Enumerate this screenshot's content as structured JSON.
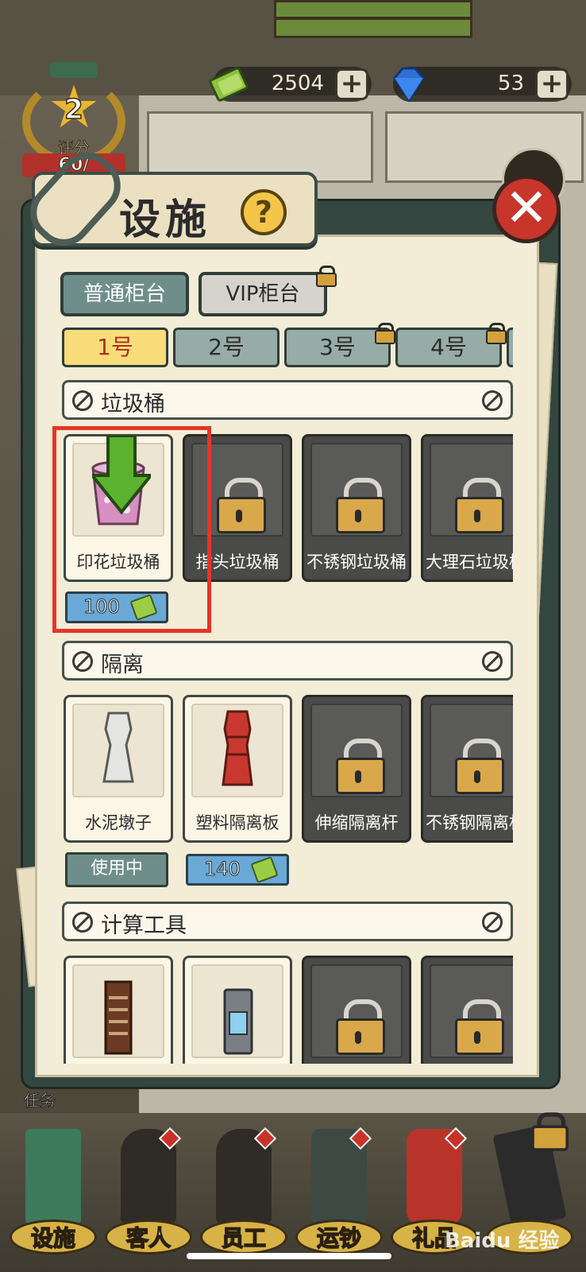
{
  "hud": {
    "rating_level": "2",
    "rating_label": "评分",
    "rating_progress": "60/",
    "cash_value": "2504",
    "gem_value": "53",
    "plus_label": "+"
  },
  "modal": {
    "title": "设施",
    "help_symbol": "?",
    "close_symbol": "✕",
    "counter_type_tabs": [
      {
        "label": "普通柜台",
        "state": "active"
      },
      {
        "label": "VIP柜台",
        "state": "locked"
      }
    ],
    "counter_number_tabs": [
      {
        "label": "1号",
        "state": "active"
      },
      {
        "label": "2号",
        "state": "inactive"
      },
      {
        "label": "3号",
        "state": "locked"
      },
      {
        "label": "4号",
        "state": "locked"
      }
    ],
    "sections": [
      {
        "title": "垃圾桶",
        "items": [
          {
            "name": "印花垃圾桶",
            "locked": false,
            "price": "100"
          },
          {
            "name": "指头垃圾桶",
            "locked": true
          },
          {
            "name": "不锈钢垃圾桶",
            "locked": true
          },
          {
            "name": "大理石垃圾桶",
            "locked": true
          }
        ]
      },
      {
        "title": "隔离",
        "items": [
          {
            "name": "水泥墩子",
            "locked": false,
            "status": "使用中"
          },
          {
            "name": "塑料隔离板",
            "locked": false,
            "price": "140"
          },
          {
            "name": "伸缩隔离杆",
            "locked": true
          },
          {
            "name": "不锈钢隔离杆",
            "locked": true
          }
        ]
      },
      {
        "title": "计算工具",
        "items": [
          {
            "name": "",
            "locked": false
          },
          {
            "name": "",
            "locked": false
          },
          {
            "name": "",
            "locked": true
          },
          {
            "name": "",
            "locked": true
          }
        ]
      }
    ]
  },
  "task_label": "任务",
  "bottom_nav": [
    {
      "label": "设施",
      "badge": false
    },
    {
      "label": "客人",
      "badge": true
    },
    {
      "label": "员工",
      "badge": true
    },
    {
      "label": "运钞",
      "badge": true
    },
    {
      "label": "礼品",
      "badge": true
    },
    {
      "label": "",
      "badge": false
    }
  ],
  "watermark": "Baidu 经验",
  "colors": {
    "highlight": "#e5352a",
    "active_tab": "#f8dd7a",
    "price_tag": "#6aa8d6",
    "modal_frame": "#344640",
    "paper": "#f3ecd6"
  }
}
